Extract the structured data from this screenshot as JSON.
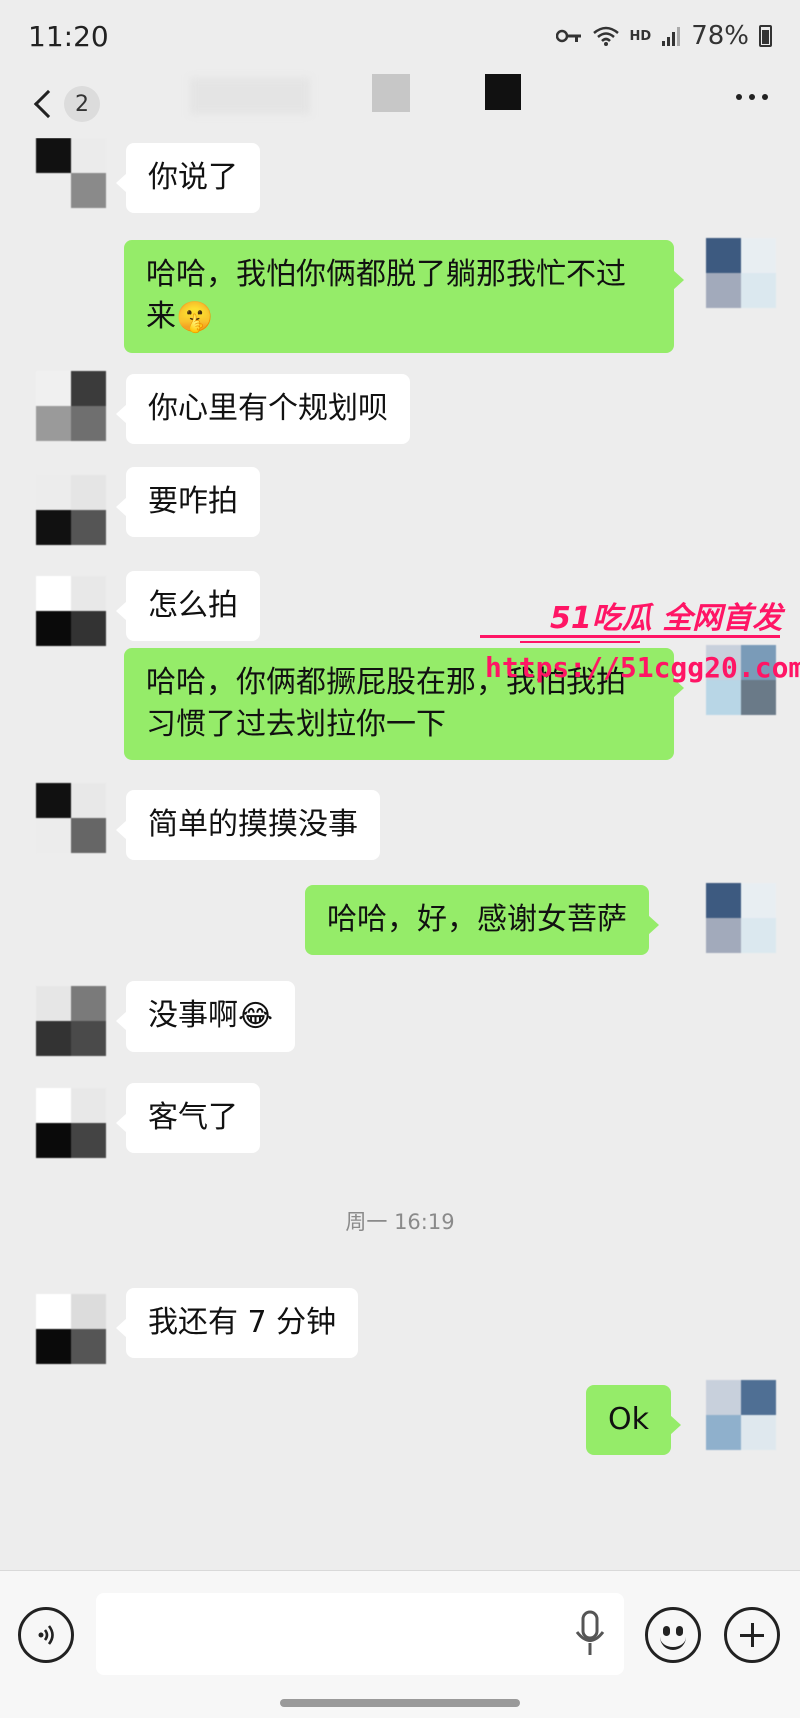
{
  "status_bar": {
    "time": "11:20",
    "network_label": "HD",
    "battery": "78%"
  },
  "header": {
    "unread_count": "2"
  },
  "watermark": {
    "brand": "51吃瓜 全网首发",
    "url": "https://51cgg20.com"
  },
  "messages": [
    {
      "side": "in",
      "text": "你说了"
    },
    {
      "side": "out",
      "text": "哈哈，我怕你俩都脱了躺那我忙不过",
      "text2": "来",
      "emoji": "🤫"
    },
    {
      "side": "in",
      "text": "你心里有个规划呗"
    },
    {
      "side": "in",
      "text": "要咋拍"
    },
    {
      "side": "in",
      "text": "怎么拍"
    },
    {
      "side": "out",
      "text": "哈哈，你俩都撅屁股在那，我怕我拍",
      "text2": "习惯了过去划拉你一下"
    },
    {
      "side": "in",
      "text": "简单的摸摸没事"
    },
    {
      "side": "out",
      "text": "哈哈，好，感谢女菩萨"
    },
    {
      "side": "in",
      "text": "没事啊",
      "emoji": "😂"
    },
    {
      "side": "in",
      "text": "客气了"
    },
    {
      "side": "in",
      "text": "我还有 7 分钟"
    },
    {
      "side": "out",
      "text": "Ok"
    }
  ],
  "timestamp": "周一 16:19",
  "colors": {
    "background": "#ededed",
    "outgoing_bubble": "#95ec69",
    "incoming_bubble": "#ffffff",
    "watermark": "#ff1565"
  },
  "icons": [
    "back-chevron-icon",
    "more-dots-icon",
    "voice-icon",
    "microphone-icon",
    "emoji-icon",
    "plus-icon"
  ]
}
